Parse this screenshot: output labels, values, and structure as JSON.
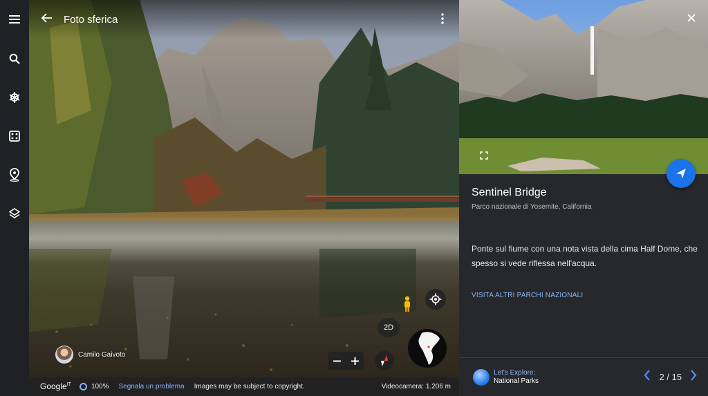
{
  "viewer": {
    "title": "Foto sferica",
    "author": "Camilo Gaivoto",
    "mode_toggle": "2D",
    "footer": {
      "brand": "Google",
      "brand_sup": "IT",
      "progress": "100%",
      "report": "Segnala un problema",
      "copyright": "Images may be subject to copyright.",
      "camera": "Videocamera: 1.206 m"
    }
  },
  "rail": {
    "icons": [
      "menu-icon",
      "search-icon",
      "voyager-icon",
      "dice-icon",
      "place-icon",
      "layers-icon"
    ]
  },
  "panel": {
    "title": "Sentinel Bridge",
    "subtitle": "Parco nazionale di Yosemite, California",
    "description": "Ponte sul fiume con una nota vista della cima Half Dome, che spesso si vede riflessa nell'acqua.",
    "link": "VISITA ALTRI PARCHI NAZIONALI",
    "story_line1": "Let's Explore:",
    "story_line2": "National Parks",
    "page": "2 / 15"
  },
  "colors": {
    "accent": "#1a73e8",
    "link": "#8ab4f8",
    "panel_bg": "#26282b",
    "rail_bg": "#202124"
  }
}
